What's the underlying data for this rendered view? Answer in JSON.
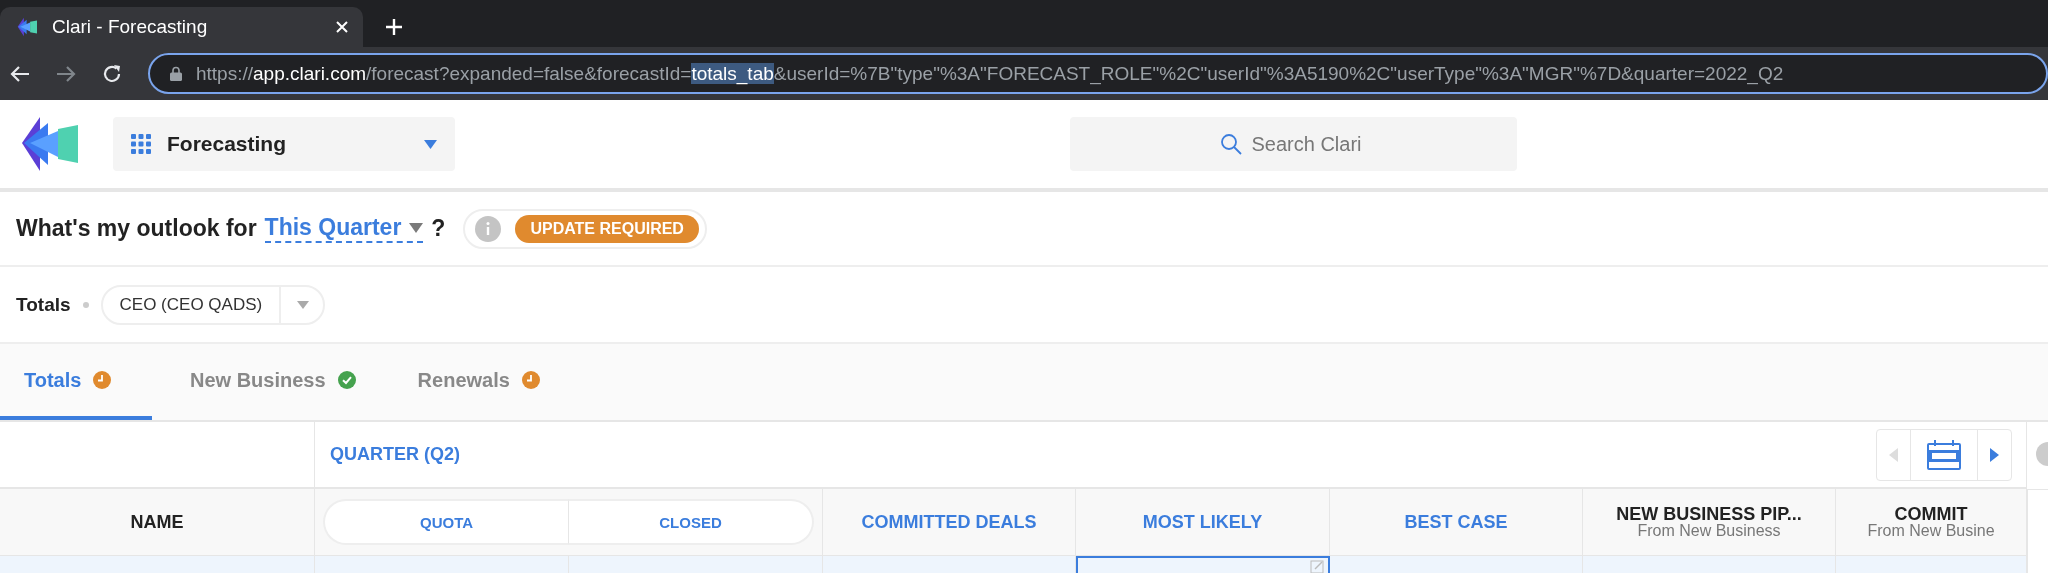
{
  "browser": {
    "tabs": [
      {
        "title": "Clari - Forecasting"
      }
    ],
    "url": {
      "scheme": "https://",
      "host": "app.clari.com",
      "path": "/forecast?expanded=false&forecastId=",
      "selection": "totals_tab",
      "rest": "&userId=%7B\"type\"%3A\"FORECAST_ROLE\"%2C\"userId\"%3A5190%2C\"userType\"%3A\"MGR\"%7D&quarter=2022_Q2"
    }
  },
  "app_header": {
    "module": "Forecasting",
    "search": {
      "placeholder": "Search Clari"
    }
  },
  "outlook": {
    "prefix": "What's my outlook for",
    "period": "This Quarter",
    "suffix": "?",
    "badge": "UPDATE REQUIRED"
  },
  "scope": {
    "label": "Totals",
    "selector": "CEO (CEO QADS)"
  },
  "tabs": [
    {
      "label": "Totals",
      "selected": true,
      "completed": false
    },
    {
      "label": "New Business",
      "selected": false,
      "completed": true
    },
    {
      "label": "Renewals",
      "selected": false,
      "completed": false
    }
  ],
  "table": {
    "period": "QUARTER (Q2)",
    "prev": {
      "disabled": true
    },
    "next": {
      "disabled": false
    },
    "columns": [
      {
        "title": "NAME",
        "kind": "name"
      },
      {
        "title": "QUOTA",
        "kind": "pill"
      },
      {
        "title": "CLOSED",
        "kind": "pill"
      },
      {
        "title": "COMMITTED DEALS",
        "kind": "metric"
      },
      {
        "title": "MOST LIKELY",
        "kind": "metric"
      },
      {
        "title": "BEST CASE",
        "kind": "metric"
      },
      {
        "title": "NEW BUSINESS PIP...",
        "subtitle": "From New Business",
        "kind": "source"
      },
      {
        "title": "COMMIT",
        "subtitle": "From New Busine",
        "kind": "source"
      }
    ],
    "rows": [
      {
        "cells": [
          {
            "focused": false
          },
          {
            "focused": false
          },
          {
            "focused": false
          },
          {
            "focused": false
          },
          {
            "focused": true
          },
          {
            "focused": false
          },
          {
            "focused": false
          },
          {
            "focused": false
          }
        ]
      }
    ]
  }
}
